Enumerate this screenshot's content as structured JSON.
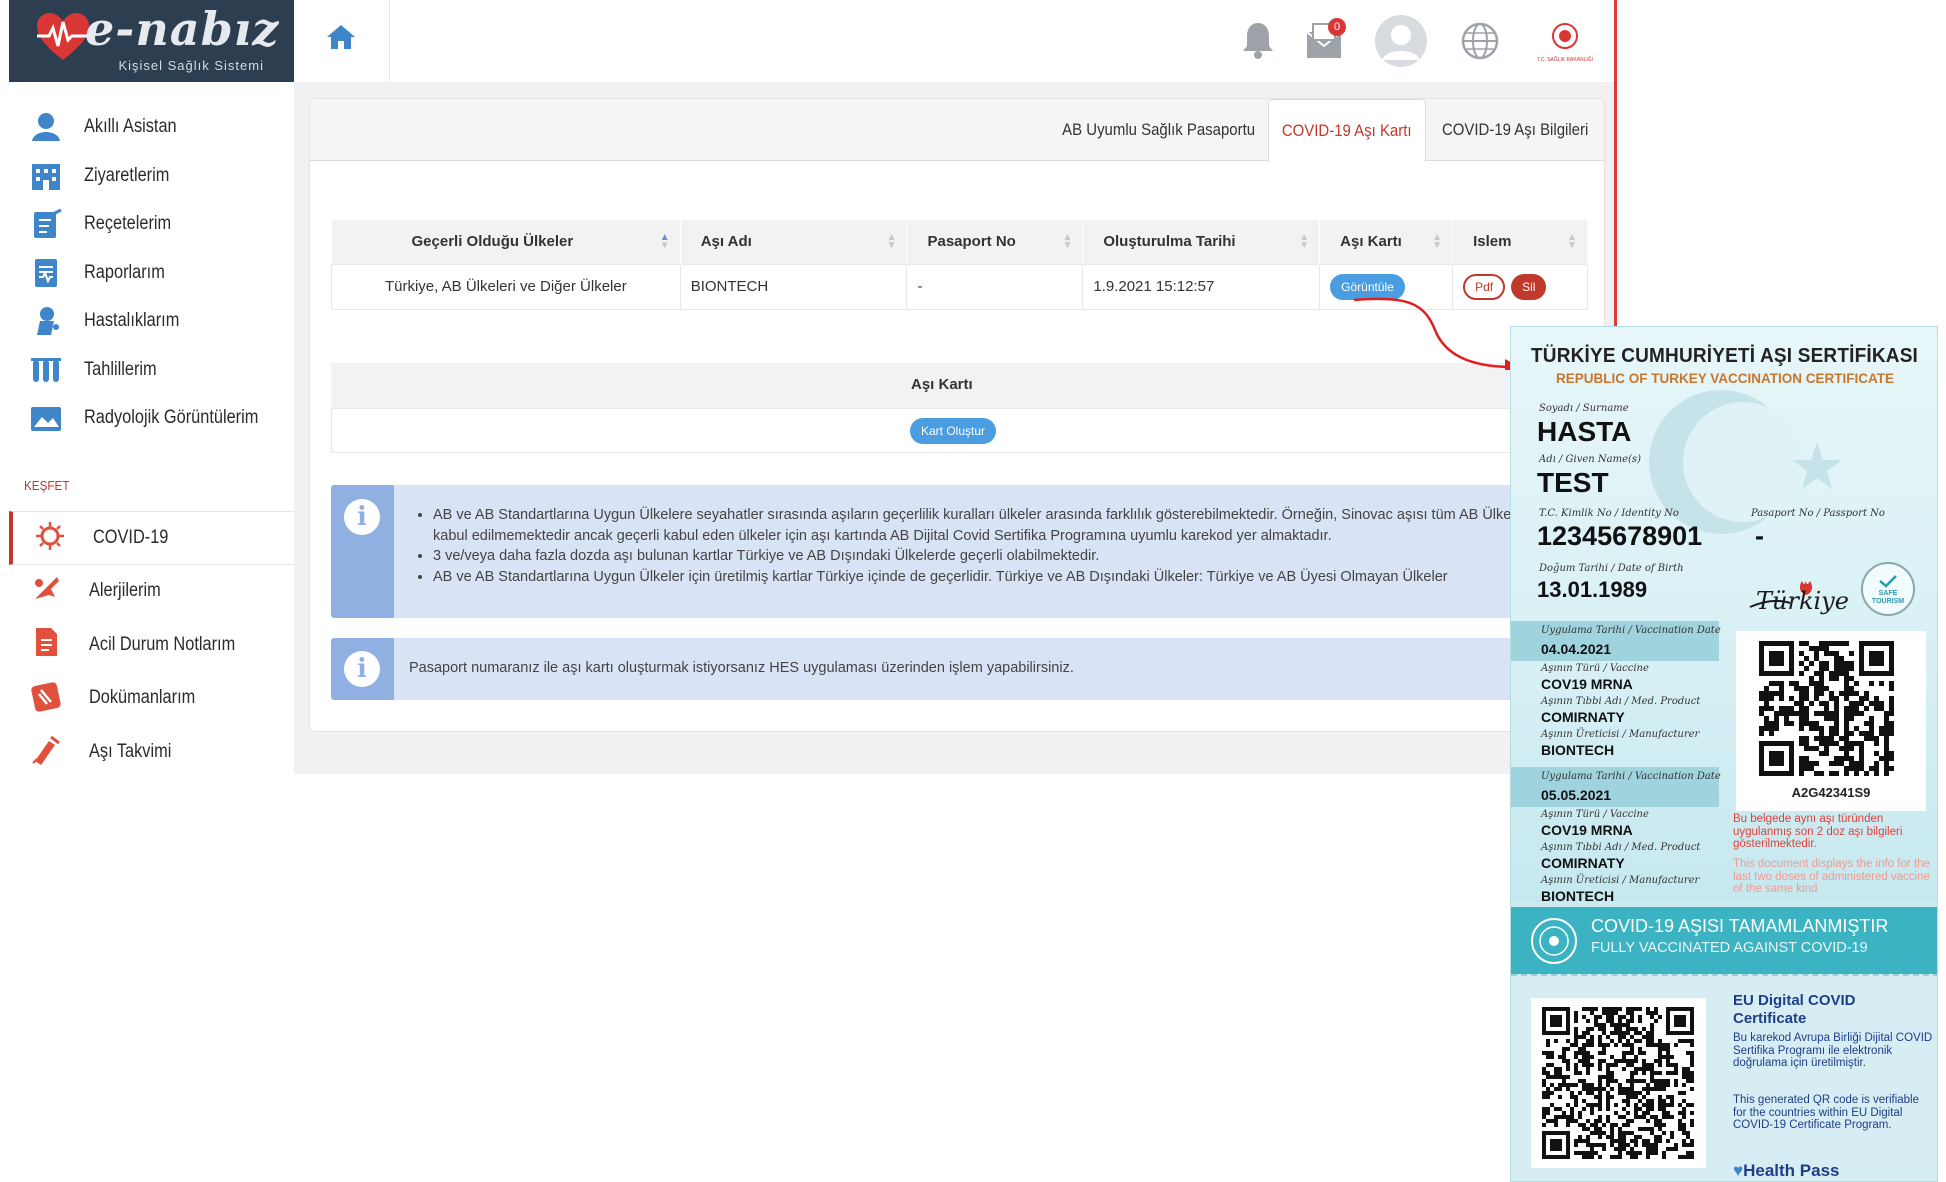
{
  "app": {
    "logo_text": "e-nabız",
    "logo_subtitle": "Kişisel Sağlık Sistemi"
  },
  "header": {
    "notification_count": "0",
    "ministry_logo_caption": "T.C. SAĞLIK BAKANLIĞI",
    "icons": [
      "home-icon",
      "bell-icon",
      "mail-icon",
      "user-avatar-icon",
      "globe-icon",
      "ministry-logo-icon"
    ]
  },
  "sidebar": {
    "items": [
      {
        "label": "Akıllı Asistan",
        "icon": "assistant-icon"
      },
      {
        "label": "Ziyaretlerim",
        "icon": "hospital-icon"
      },
      {
        "label": "Reçetelerim",
        "icon": "prescription-icon"
      },
      {
        "label": "Raporlarım",
        "icon": "report-icon"
      },
      {
        "label": "Hastalıklarım",
        "icon": "disease-icon"
      },
      {
        "label": "Tahlillerim",
        "icon": "test-tubes-icon"
      },
      {
        "label": "Radyolojik Görüntülerim",
        "icon": "radiology-icon"
      }
    ],
    "section_label": "KEŞFET",
    "explore_items": [
      {
        "label": "COVID-19",
        "icon": "virus-icon",
        "active": true
      },
      {
        "label": "Alerjilerim",
        "icon": "allergy-icon"
      },
      {
        "label": "Acil Durum Notlarım",
        "icon": "emergency-note-icon"
      },
      {
        "label": "Dokümanlarım",
        "icon": "document-icon"
      },
      {
        "label": "Aşı Takvimi",
        "icon": "vaccine-calendar-icon"
      }
    ]
  },
  "tabs": [
    {
      "label": "AB Uyumlu Sağlık Pasaportu",
      "active": false
    },
    {
      "label": "COVID-19 Aşı Kartı",
      "active": true
    },
    {
      "label": "COVID-19 Aşı Bilgileri",
      "active": false
    }
  ],
  "table": {
    "headers": [
      "Geçerli Olduğu Ülkeler",
      "Aşı Adı",
      "Pasaport No",
      "Oluşturulma Tarihi",
      "Aşı Kartı",
      "Islem"
    ],
    "rows": [
      {
        "countries": "Türkiye, AB Ülkeleri ve Diğer Ülkeler",
        "vaccine": "BIONTECH",
        "passport": "-",
        "created": "1.9.2021 15:12:57",
        "view_button": "Görüntüle",
        "pdf_button": "Pdf",
        "delete_button": "Sil"
      }
    ]
  },
  "card_section": {
    "header": "Aşı Kartı",
    "create_button": "Kart Oluştur"
  },
  "info1": {
    "bullets": [
      "AB ve AB Standartlarına Uygun Ülkelere seyahatler sırasında aşıların geçerlilik kuralları ülkeler arasında farklılık gösterebilmektedir. Örneğin, Sinovac aşısı tüm AB Ülkelerinde kabul edilmemektedir ancak geçerli kabul eden ülkeler için aşı kartında AB Dijital Covid Sertifika Programına uyumlu karekod yer almaktadır.",
      "3 ve/veya daha fazla dozda aşı bulunan kartlar Türkiye ve AB Dışındaki Ülkelerde geçerli olabilmektedir.",
      "AB ve AB Standartlarına Uygun Ülkeler için üretilmiş kartlar Türkiye içinde de geçerlidir. Türkiye ve AB Dışındaki Ülkeler: Türkiye ve AB Üyesi Olmayan Ülkeler"
    ]
  },
  "info2": {
    "text": "Pasaport numaranız ile aşı kartı oluşturmak istiyorsanız HES uygulaması üzerinden işlem yapabilirsiniz."
  },
  "certificate": {
    "title": "TÜRKİYE CUMHURİYETİ AŞI SERTİFİKASI",
    "subtitle": "REPUBLIC OF TURKEY VACCINATION CERTIFICATE",
    "surname_label": "Soyadı / Surname",
    "surname": "HASTA",
    "name_label": "Adı / Given Name(s)",
    "name": "TEST",
    "id_label": "T.C. Kimlik No / Identity No",
    "id": "12345678901",
    "passport_label": "Pasaport No / Passport No",
    "passport": "-",
    "dob_label": "Doğum Tarihi / Date of Birth",
    "dob": "13.01.1989",
    "turkiye_logo": "Türkiye",
    "safe_tourism": "SAFE TOURISM",
    "doses": [
      {
        "date_label": "Uygulama Tarihi / Vaccination Date",
        "date": "04.04.2021",
        "type_label": "Aşının Türü / Vaccine",
        "type": "COV19 MRNA",
        "product_label": "Aşının Tıbbi Adı / Med. Product",
        "product": "COMIRNATY",
        "maker_label": "Aşının Üreticisi / Manufacturer",
        "maker": "BIONTECH"
      },
      {
        "date_label": "Uygulama Tarihi / Vaccination Date",
        "date": "05.05.2021",
        "type_label": "Aşının Türü / Vaccine",
        "type": "COV19 MRNA",
        "product_label": "Aşının Tıbbi Adı / Med. Product",
        "product": "COMIRNATY",
        "maker_label": "Aşının Üreticisi / Manufacturer",
        "maker": "BIONTECH"
      }
    ],
    "qr_code_id": "A2G42341S9",
    "note_tr": "Bu belgede aynı aşı türünden uygulanmış son 2 doz aşı bilgileri gösterilmektedir.",
    "note_en": "This document displays the info for the last two doses of administered vaccine of the same kind",
    "band_tr": "COVID-19 AŞISI TAMAMLANMIŞTIR",
    "band_en": "FULLY VACCINATED AGAINST COVID-19",
    "eu_title": "EU Digital COVID Certificate",
    "eu_text_tr": "Bu karekod Avrupa Birliği Dijital COVID Sertifika Programı ile elektronik doğrulama için üretilmiştir.",
    "eu_text_en": "This generated QR code is verifiable for the countries within EU Digital COVID-19 Certificate Program.",
    "health_pass": "Health Pass"
  },
  "colors": {
    "brand_red": "#c0392b",
    "header_dark": "#2d3e50",
    "button_blue": "#4a9de0",
    "info_bg": "#d8e4f5",
    "cert_teal": "#3cb3c3"
  }
}
